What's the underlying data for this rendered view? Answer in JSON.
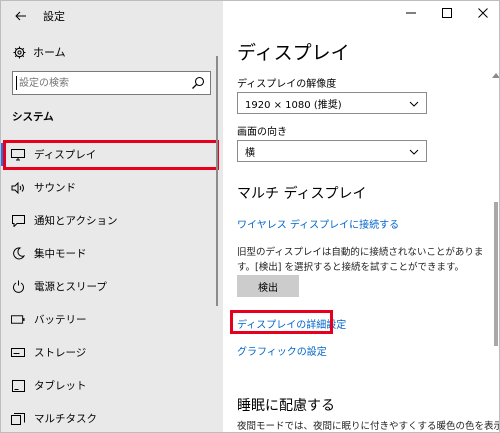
{
  "window": {
    "title": "設定",
    "controls": {
      "minimize": "—",
      "maximize": "☐",
      "close": "✕"
    }
  },
  "sidebar": {
    "home_label": "ホーム",
    "search_placeholder": "設定の検索",
    "section_title": "システム",
    "items": [
      {
        "label": "ディスプレイ",
        "icon": "display-icon",
        "active": true
      },
      {
        "label": "サウンド",
        "icon": "speaker-icon"
      },
      {
        "label": "通知とアクション",
        "icon": "notification-icon"
      },
      {
        "label": "集中モード",
        "icon": "moon-icon"
      },
      {
        "label": "電源とスリープ",
        "icon": "power-icon"
      },
      {
        "label": "バッテリー",
        "icon": "battery-icon"
      },
      {
        "label": "ストレージ",
        "icon": "storage-icon"
      },
      {
        "label": "タブレット",
        "icon": "tablet-icon"
      },
      {
        "label": "マルチタスク",
        "icon": "multitask-icon"
      }
    ]
  },
  "main": {
    "title": "ディスプレイ",
    "resolution": {
      "label": "ディスプレイの解像度",
      "value": "1920 × 1080 (推奨)"
    },
    "orientation": {
      "label": "画面の向き",
      "value": "横"
    },
    "multi_display": {
      "title": "マルチ ディスプレイ",
      "wireless_link": "ワイヤレス ディスプレイに接続する",
      "description": "旧型のディスプレイは自動的に接続されないことがあります。[検出] を選択すると接続を試すことができます。",
      "detect_button": "検出",
      "advanced_link": "ディスプレイの詳細設定",
      "graphics_link": "グラフィックの設定"
    },
    "sleep": {
      "title": "睡眠に配慮する",
      "description": "夜間モードでは、夜間に眠りに付きやすくする暖色の色を表示で"
    }
  },
  "colors": {
    "accent": "#0066cc",
    "highlight": "#e6001e",
    "sidebar_bg": "#e9e9e9"
  }
}
